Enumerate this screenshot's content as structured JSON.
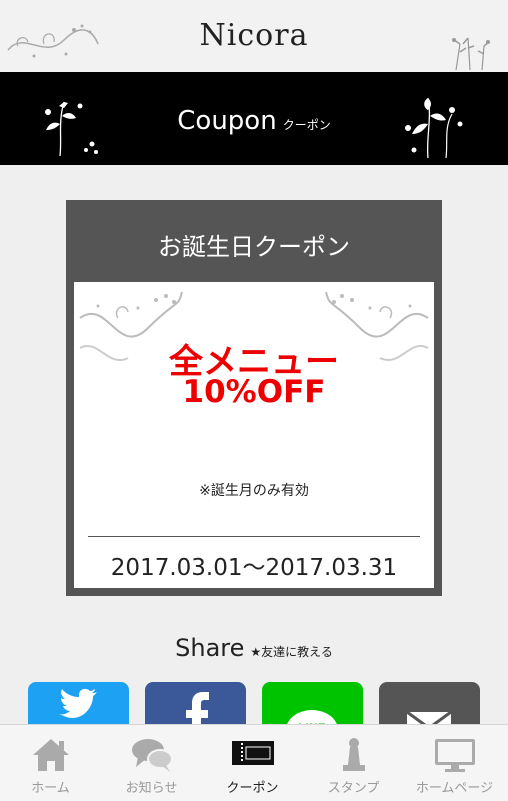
{
  "header": {
    "logo": "Nicora"
  },
  "banner": {
    "title_en": "Coupon",
    "title_jp": "クーポン"
  },
  "coupon": {
    "title": "お誕生日クーポン",
    "offer_line1": "全メニュー",
    "offer_line2": "10%OFF",
    "note": "※誕生月のみ有効",
    "period": "2017.03.01～2017.03.31"
  },
  "share": {
    "title": "Share",
    "subtitle": "★友達に教える",
    "buttons": [
      {
        "icon": "twitter-icon",
        "color": "#1da1f2"
      },
      {
        "icon": "facebook-icon",
        "color": "#3b5998"
      },
      {
        "icon": "line-icon",
        "color": "#00c300"
      },
      {
        "icon": "mail-icon",
        "color": "#555555"
      }
    ]
  },
  "nav": {
    "items": [
      {
        "label": "ホーム",
        "icon": "home-icon"
      },
      {
        "label": "お知らせ",
        "icon": "chat-bubbles-icon"
      },
      {
        "label": "クーポン",
        "icon": "ticket-icon"
      },
      {
        "label": "スタンプ",
        "icon": "stamp-icon"
      },
      {
        "label": "ホームページ",
        "icon": "monitor-icon"
      }
    ],
    "active": "クーポン"
  },
  "colors": {
    "accent_red": "#e00000",
    "banner_bg": "#000000",
    "coupon_frame": "#555555"
  }
}
